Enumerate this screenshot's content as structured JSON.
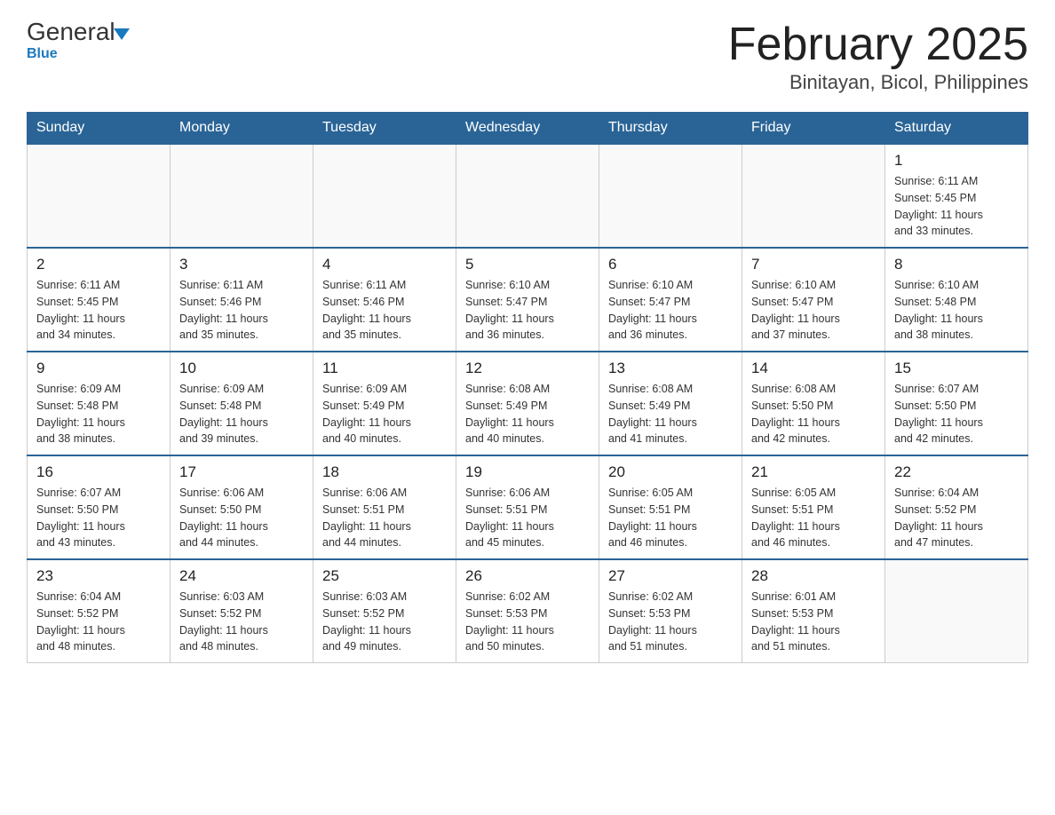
{
  "header": {
    "logo_general": "General",
    "logo_blue": "Blue",
    "title": "February 2025",
    "subtitle": "Binitayan, Bicol, Philippines"
  },
  "calendar": {
    "days_of_week": [
      "Sunday",
      "Monday",
      "Tuesday",
      "Wednesday",
      "Thursday",
      "Friday",
      "Saturday"
    ],
    "weeks": [
      {
        "days": [
          {
            "date": "",
            "info": ""
          },
          {
            "date": "",
            "info": ""
          },
          {
            "date": "",
            "info": ""
          },
          {
            "date": "",
            "info": ""
          },
          {
            "date": "",
            "info": ""
          },
          {
            "date": "",
            "info": ""
          },
          {
            "date": "1",
            "info": "Sunrise: 6:11 AM\nSunset: 5:45 PM\nDaylight: 11 hours\nand 33 minutes."
          }
        ]
      },
      {
        "days": [
          {
            "date": "2",
            "info": "Sunrise: 6:11 AM\nSunset: 5:45 PM\nDaylight: 11 hours\nand 34 minutes."
          },
          {
            "date": "3",
            "info": "Sunrise: 6:11 AM\nSunset: 5:46 PM\nDaylight: 11 hours\nand 35 minutes."
          },
          {
            "date": "4",
            "info": "Sunrise: 6:11 AM\nSunset: 5:46 PM\nDaylight: 11 hours\nand 35 minutes."
          },
          {
            "date": "5",
            "info": "Sunrise: 6:10 AM\nSunset: 5:47 PM\nDaylight: 11 hours\nand 36 minutes."
          },
          {
            "date": "6",
            "info": "Sunrise: 6:10 AM\nSunset: 5:47 PM\nDaylight: 11 hours\nand 36 minutes."
          },
          {
            "date": "7",
            "info": "Sunrise: 6:10 AM\nSunset: 5:47 PM\nDaylight: 11 hours\nand 37 minutes."
          },
          {
            "date": "8",
            "info": "Sunrise: 6:10 AM\nSunset: 5:48 PM\nDaylight: 11 hours\nand 38 minutes."
          }
        ]
      },
      {
        "days": [
          {
            "date": "9",
            "info": "Sunrise: 6:09 AM\nSunset: 5:48 PM\nDaylight: 11 hours\nand 38 minutes."
          },
          {
            "date": "10",
            "info": "Sunrise: 6:09 AM\nSunset: 5:48 PM\nDaylight: 11 hours\nand 39 minutes."
          },
          {
            "date": "11",
            "info": "Sunrise: 6:09 AM\nSunset: 5:49 PM\nDaylight: 11 hours\nand 40 minutes."
          },
          {
            "date": "12",
            "info": "Sunrise: 6:08 AM\nSunset: 5:49 PM\nDaylight: 11 hours\nand 40 minutes."
          },
          {
            "date": "13",
            "info": "Sunrise: 6:08 AM\nSunset: 5:49 PM\nDaylight: 11 hours\nand 41 minutes."
          },
          {
            "date": "14",
            "info": "Sunrise: 6:08 AM\nSunset: 5:50 PM\nDaylight: 11 hours\nand 42 minutes."
          },
          {
            "date": "15",
            "info": "Sunrise: 6:07 AM\nSunset: 5:50 PM\nDaylight: 11 hours\nand 42 minutes."
          }
        ]
      },
      {
        "days": [
          {
            "date": "16",
            "info": "Sunrise: 6:07 AM\nSunset: 5:50 PM\nDaylight: 11 hours\nand 43 minutes."
          },
          {
            "date": "17",
            "info": "Sunrise: 6:06 AM\nSunset: 5:50 PM\nDaylight: 11 hours\nand 44 minutes."
          },
          {
            "date": "18",
            "info": "Sunrise: 6:06 AM\nSunset: 5:51 PM\nDaylight: 11 hours\nand 44 minutes."
          },
          {
            "date": "19",
            "info": "Sunrise: 6:06 AM\nSunset: 5:51 PM\nDaylight: 11 hours\nand 45 minutes."
          },
          {
            "date": "20",
            "info": "Sunrise: 6:05 AM\nSunset: 5:51 PM\nDaylight: 11 hours\nand 46 minutes."
          },
          {
            "date": "21",
            "info": "Sunrise: 6:05 AM\nSunset: 5:51 PM\nDaylight: 11 hours\nand 46 minutes."
          },
          {
            "date": "22",
            "info": "Sunrise: 6:04 AM\nSunset: 5:52 PM\nDaylight: 11 hours\nand 47 minutes."
          }
        ]
      },
      {
        "days": [
          {
            "date": "23",
            "info": "Sunrise: 6:04 AM\nSunset: 5:52 PM\nDaylight: 11 hours\nand 48 minutes."
          },
          {
            "date": "24",
            "info": "Sunrise: 6:03 AM\nSunset: 5:52 PM\nDaylight: 11 hours\nand 48 minutes."
          },
          {
            "date": "25",
            "info": "Sunrise: 6:03 AM\nSunset: 5:52 PM\nDaylight: 11 hours\nand 49 minutes."
          },
          {
            "date": "26",
            "info": "Sunrise: 6:02 AM\nSunset: 5:53 PM\nDaylight: 11 hours\nand 50 minutes."
          },
          {
            "date": "27",
            "info": "Sunrise: 6:02 AM\nSunset: 5:53 PM\nDaylight: 11 hours\nand 51 minutes."
          },
          {
            "date": "28",
            "info": "Sunrise: 6:01 AM\nSunset: 5:53 PM\nDaylight: 11 hours\nand 51 minutes."
          },
          {
            "date": "",
            "info": ""
          }
        ]
      }
    ]
  }
}
